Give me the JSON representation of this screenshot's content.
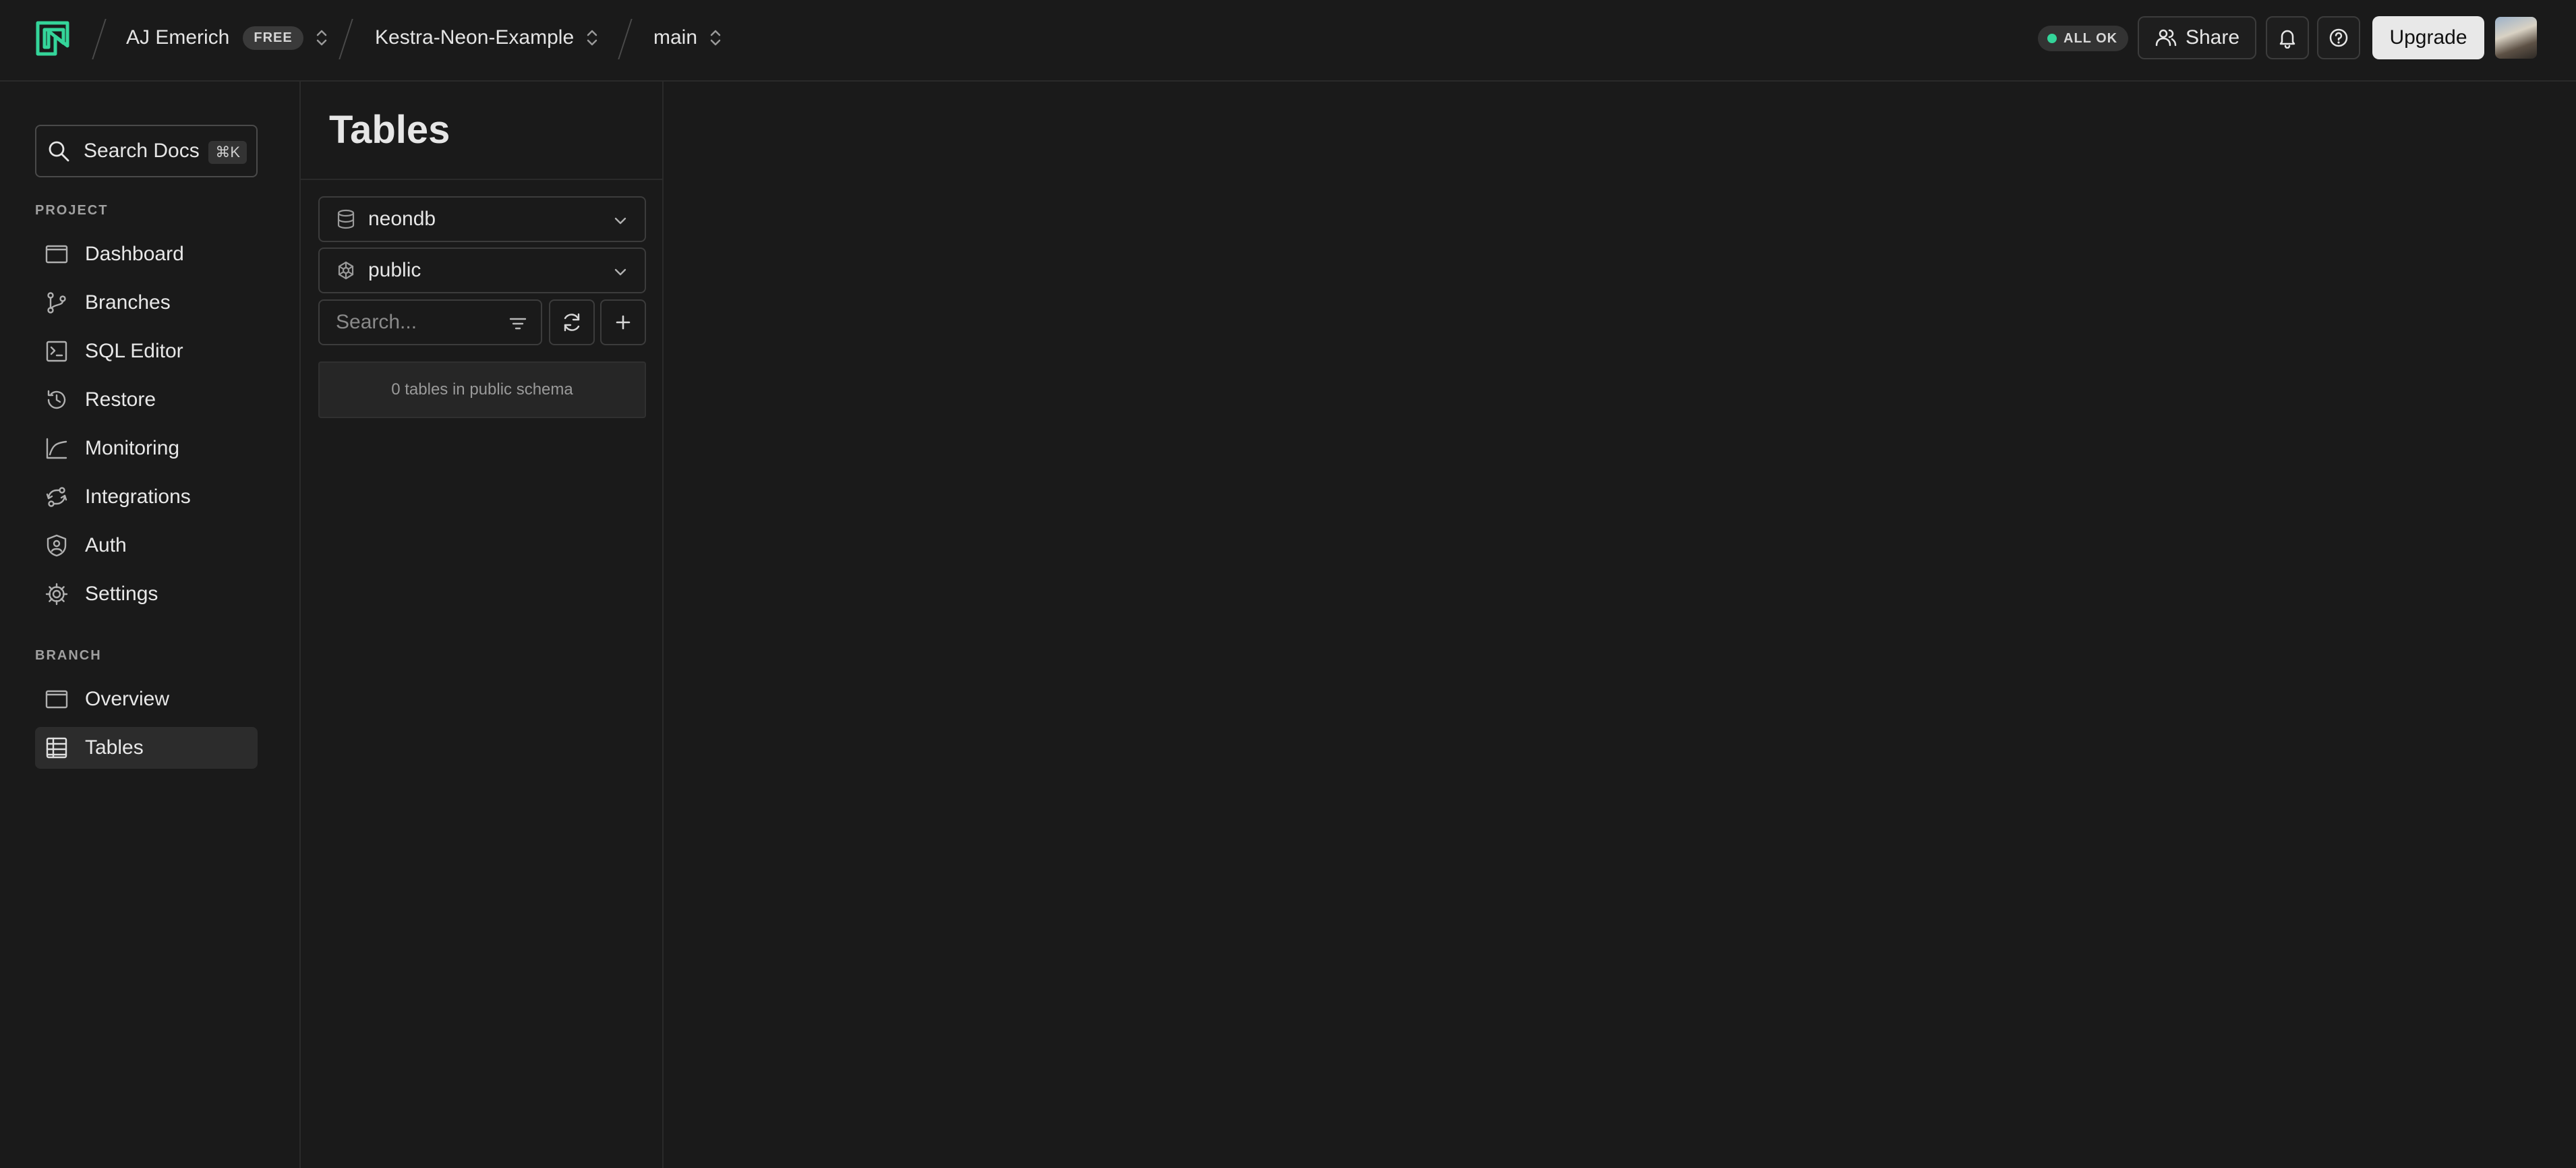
{
  "topbar": {
    "org_name": "AJ Emerich",
    "plan_badge": "FREE",
    "project_name": "Kestra-Neon-Example",
    "branch_name": "main",
    "status": "ALL OK",
    "status_color": "#34d59a",
    "share_label": "Share",
    "upgrade_label": "Upgrade",
    "icons": [
      "neon-logo-icon",
      "chevron-updown-icon",
      "users-icon",
      "bell-icon",
      "help-icon"
    ]
  },
  "sidebar": {
    "search_label": "Search Docs",
    "search_shortcut": "⌘K",
    "project_section": "PROJECT",
    "project_items": [
      {
        "label": "Dashboard",
        "icon": "dashboard-icon"
      },
      {
        "label": "Branches",
        "icon": "branches-icon"
      },
      {
        "label": "SQL Editor",
        "icon": "sql-editor-icon"
      },
      {
        "label": "Restore",
        "icon": "restore-icon"
      },
      {
        "label": "Monitoring",
        "icon": "monitoring-icon"
      },
      {
        "label": "Integrations",
        "icon": "integrations-icon"
      },
      {
        "label": "Auth",
        "icon": "auth-icon"
      },
      {
        "label": "Settings",
        "icon": "settings-icon"
      }
    ],
    "branch_section": "BRANCH",
    "branch_items": [
      {
        "label": "Overview",
        "icon": "overview-icon"
      },
      {
        "label": "Tables",
        "icon": "tables-icon",
        "active": true
      }
    ]
  },
  "tables_panel": {
    "title": "Tables",
    "database": "neondb",
    "schema": "public",
    "search_placeholder": "Search...",
    "empty_message": "0 tables in public schema"
  }
}
